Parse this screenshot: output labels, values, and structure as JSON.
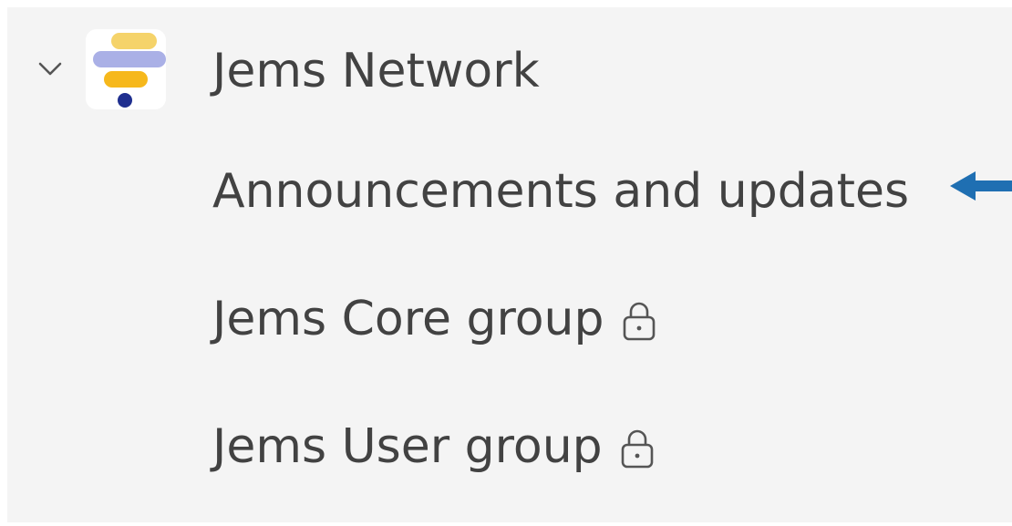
{
  "team": {
    "name": "Jems Network",
    "logo_icon": "jems-network-logo",
    "expand_icon": "chevron-down-icon"
  },
  "channels": [
    {
      "label": "Announcements and updates",
      "private": false
    },
    {
      "label": "Jems Core group",
      "private": true
    },
    {
      "label": "Jems User group",
      "private": true
    }
  ],
  "annotation": {
    "arrow_icon": "arrow-left-icon",
    "arrow_color": "#1f6fb2"
  },
  "colors": {
    "panel_bg": "#f4f4f4",
    "text": "#424242",
    "logo_yellow_light": "#f5d36a",
    "logo_lavender": "#aab0e6",
    "logo_yellow": "#f6b81c",
    "logo_navy": "#1f2f8f"
  }
}
